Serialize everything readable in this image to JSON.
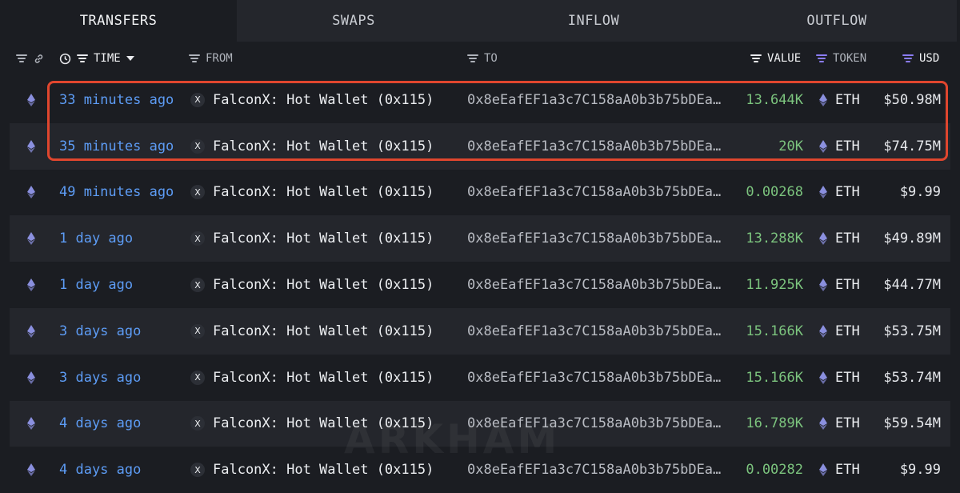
{
  "tabs": [
    {
      "label": "TRANSFERS",
      "active": true
    },
    {
      "label": "SWAPS",
      "active": false
    },
    {
      "label": "INFLOW",
      "active": false
    },
    {
      "label": "OUTFLOW",
      "active": false
    }
  ],
  "columns": {
    "time": "TIME",
    "from": "FROM",
    "to": "TO",
    "value": "VALUE",
    "token": "TOKEN",
    "usd": "USD"
  },
  "watermark": "ARKHAM",
  "colors": {
    "accent_time": "#5d9cf5",
    "value_green": "#7cc47e",
    "highlight": "#e0462e",
    "filter_purple": "#8b7cf6"
  },
  "rows": [
    {
      "time": "33 minutes ago",
      "from": "FalconX: Hot Wallet (0x115)",
      "to": "0x8eEafEF1a3c7C158aA0b3b75bDEa…",
      "value": "13.644K",
      "token": "ETH",
      "usd": "$50.98M"
    },
    {
      "time": "35 minutes ago",
      "from": "FalconX: Hot Wallet (0x115)",
      "to": "0x8eEafEF1a3c7C158aA0b3b75bDEa…",
      "value": "20K",
      "token": "ETH",
      "usd": "$74.75M"
    },
    {
      "time": "49 minutes ago",
      "from": "FalconX: Hot Wallet (0x115)",
      "to": "0x8eEafEF1a3c7C158aA0b3b75bDEa…",
      "value": "0.00268",
      "token": "ETH",
      "usd": "$9.99"
    },
    {
      "time": "1 day ago",
      "from": "FalconX: Hot Wallet (0x115)",
      "to": "0x8eEafEF1a3c7C158aA0b3b75bDEa…",
      "value": "13.288K",
      "token": "ETH",
      "usd": "$49.89M"
    },
    {
      "time": "1 day ago",
      "from": "FalconX: Hot Wallet (0x115)",
      "to": "0x8eEafEF1a3c7C158aA0b3b75bDEa…",
      "value": "11.925K",
      "token": "ETH",
      "usd": "$44.77M"
    },
    {
      "time": "3 days ago",
      "from": "FalconX: Hot Wallet (0x115)",
      "to": "0x8eEafEF1a3c7C158aA0b3b75bDEa…",
      "value": "15.166K",
      "token": "ETH",
      "usd": "$53.75M"
    },
    {
      "time": "3 days ago",
      "from": "FalconX: Hot Wallet (0x115)",
      "to": "0x8eEafEF1a3c7C158aA0b3b75bDEa…",
      "value": "15.166K",
      "token": "ETH",
      "usd": "$53.74M"
    },
    {
      "time": "4 days ago",
      "from": "FalconX: Hot Wallet (0x115)",
      "to": "0x8eEafEF1a3c7C158aA0b3b75bDEa…",
      "value": "16.789K",
      "token": "ETH",
      "usd": "$59.54M"
    },
    {
      "time": "4 days ago",
      "from": "FalconX: Hot Wallet (0x115)",
      "to": "0x8eEafEF1a3c7C158aA0b3b75bDEa…",
      "value": "0.00282",
      "token": "ETH",
      "usd": "$9.99"
    }
  ]
}
